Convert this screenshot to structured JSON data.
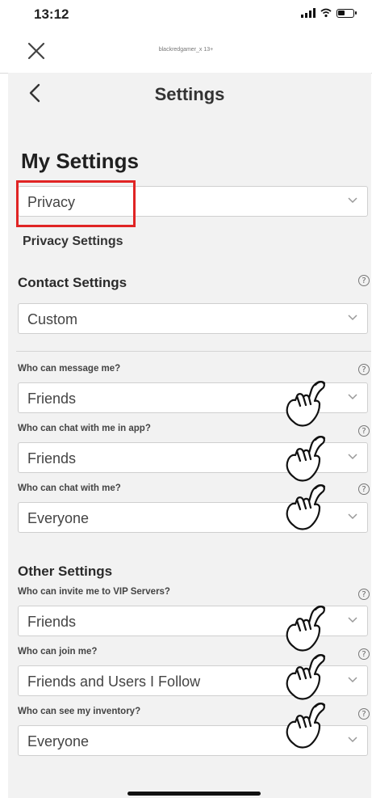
{
  "status_bar": {
    "time": "13:12",
    "battery_level": 0.45
  },
  "browser": {
    "url": "blackredgamer_x 13+"
  },
  "header": {
    "title": "Settings"
  },
  "page": {
    "title": "My Settings",
    "category_selected": "Privacy",
    "subtitle": "Privacy Settings"
  },
  "contact_settings": {
    "heading": "Contact Settings",
    "value": "Custom",
    "fields": [
      {
        "label": "Who can message me?",
        "value": "Friends"
      },
      {
        "label": "Who can chat with me in app?",
        "value": "Friends"
      },
      {
        "label": "Who can chat with me?",
        "value": "Everyone"
      }
    ]
  },
  "other_settings": {
    "heading": "Other Settings",
    "fields": [
      {
        "label": "Who can invite me to VIP Servers?",
        "value": "Friends"
      },
      {
        "label": "Who can join me?",
        "value": "Friends and Users I Follow"
      },
      {
        "label": "Who can see my inventory?",
        "value": "Everyone"
      }
    ]
  },
  "help_glyph": "?",
  "colors": {
    "highlight": "#e02424",
    "panel_bg": "#f2f2f2"
  },
  "icons": [
    "close-icon",
    "back-icon",
    "chevron-down-icon",
    "help-icon",
    "pointing-hand-icon"
  ]
}
